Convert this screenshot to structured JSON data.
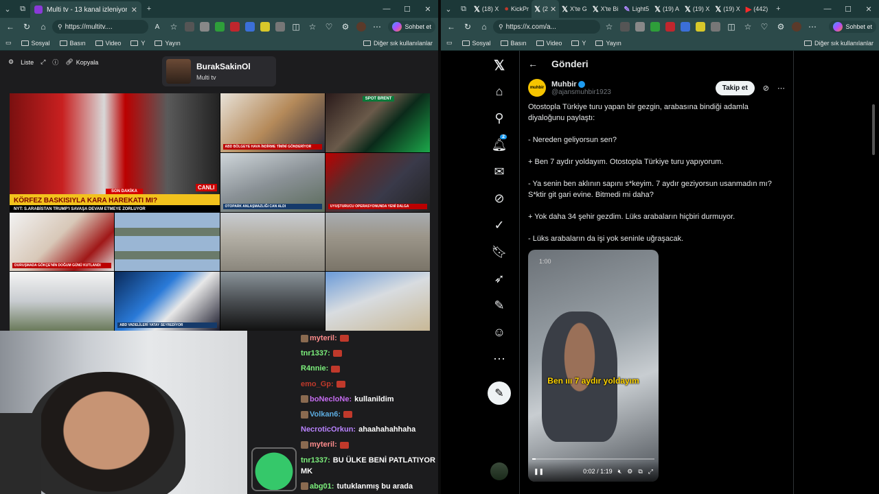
{
  "left": {
    "tab": {
      "title": "Multi tv - 13 kanal izleniyor"
    },
    "url": "https://multitv....",
    "copilot_label": "Sohbet et",
    "bookmarks": [
      "Sosyal",
      "Basın",
      "Video",
      "Y",
      "Yayın"
    ],
    "bookmarks_other": "Diğer sık kullanılanlar",
    "toolbar": {
      "list_label": "Liste",
      "copy_label": "Kopyala"
    },
    "profile": {
      "name": "BurakSakinOl",
      "subtitle": "Multi tv"
    },
    "tiles": {
      "ticker_title": "KÖRFEZ BASKISIYLA KARA HAREKATI MI?",
      "ticker_sub": "NYT: S.ARABİSTAN TRUMP'I SAVAŞA DEVAM ETMEYE ZORLUYOR",
      "breaking": "SON DAKİKA",
      "cnn": "CANLI",
      "t2": "ABD BÖLGEYE HAVA İNDİRME TİMİNİ GÖNDERİYOR",
      "t3_spot": "SPOT BRENT",
      "t4": "OTOPARK ANLAŞMAZLIĞI CAN ALDI",
      "t5": "UYUŞTURUCU OPERASYONUNDA YENİ DALGA",
      "t6": "DURUŞMADA GÖKÇE'NİN DOĞUM GÜNÜ KUTLANDI",
      "t7": "ABD VADELİLERİ YATAY SEYREDİYOR"
    },
    "chat": [
      {
        "user": "myteril:",
        "text": "",
        "color": "#ff8c8c",
        "emote": true,
        "badge": true
      },
      {
        "user": "tnr1337:",
        "text": "",
        "color": "#7cf07c",
        "emote": true
      },
      {
        "user": "R4nnie:",
        "text": "",
        "color": "#7cf07c",
        "emote": true
      },
      {
        "user": "emo_Gp:",
        "text": "",
        "color": "#c0392b",
        "emote": true
      },
      {
        "user": "boNecloNe:",
        "text": "kullanildim",
        "color": "#c56cf0",
        "badge": true
      },
      {
        "user": "Volkan6:",
        "text": "",
        "color": "#5dade2",
        "emote": true,
        "badge": true
      },
      {
        "user": "NecroticOrkun:",
        "text": "ahaahahahhaha",
        "color": "#b983ff"
      },
      {
        "user": "myteril:",
        "text": "",
        "color": "#ff8c8c",
        "emote": true,
        "badge": true
      },
      {
        "user": "tnr1337:",
        "text": "BU ÜLKE BENİ PATLATIYOR MK",
        "color": "#7cf07c"
      },
      {
        "user": "abg01:",
        "text": "tutuklanmış bu arada",
        "color": "#7cf07c",
        "badge": true
      }
    ]
  },
  "right": {
    "tabs": [
      "(18) X",
      "KickPr",
      "(2",
      "X'te G",
      "X'te Bi",
      "Light5",
      "(19) A",
      "(19) X",
      "(19) X",
      "(442)"
    ],
    "url": "https://x.com/a...",
    "copilot_label": "Sohbet et",
    "bookmarks": [
      "Sosyal",
      "Basın",
      "Video",
      "Y",
      "Yayın"
    ],
    "bookmarks_other": "Diğer sık kullanılanlar",
    "header_title": "Gönderi",
    "notif_count": "2",
    "author": {
      "name": "Muhbir",
      "handle": "@ajansmuhbir1923",
      "logo_text": "muhbir"
    },
    "follow_label": "Takip et",
    "tweet": [
      "Otostopla Türkiye turu yapan bir gezgin, arabasına bindiği adamla diyaloğunu paylaştı:",
      "- Nereden geliyorsun sen?",
      "+ Ben 7 aydır yoldayım. Otostopla Türkiye turu yapıyorum.",
      "- Ya senin ben aklının sapını s*keyim. 7 aydır geziyorsun usanmadın mı? S*ktir git gari evine. Bitmedi mi daha?",
      "+ Yok daha 34 şehir gezdim. Lüks arabaların hiçbiri durmuyor.",
      "- Lüks arabaların da işi yok seninle uğraşacak."
    ],
    "video": {
      "caption": "Ben ııı 7 aydır yoldayım",
      "badge_time": "1:00",
      "time": "0:02 / 1:19",
      "progress": 0.03
    }
  }
}
